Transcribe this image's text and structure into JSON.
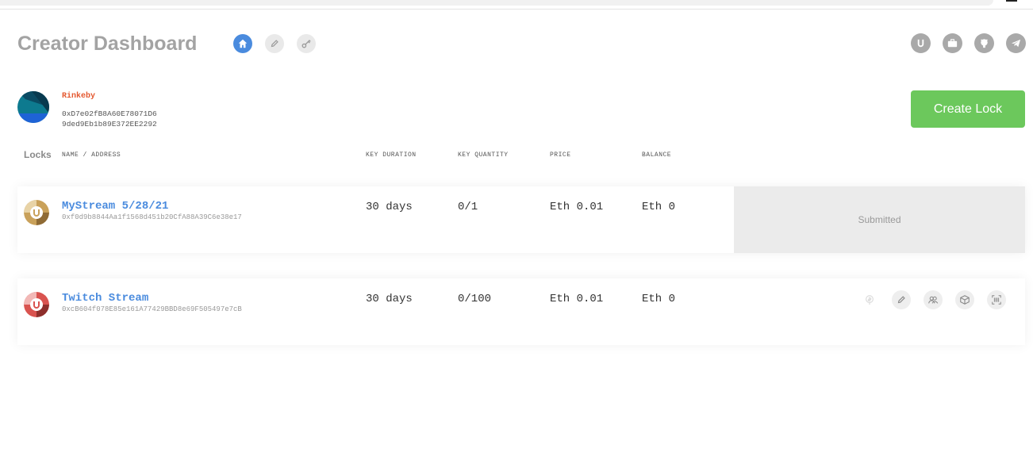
{
  "app": {
    "title": "Creator Dashboard"
  },
  "nav": [
    {
      "name": "home-icon",
      "active": true
    },
    {
      "name": "pencil-icon",
      "active": false
    },
    {
      "name": "key-icon",
      "active": false
    }
  ],
  "external_links": [
    "unlock-icon",
    "briefcase-icon",
    "github-icon",
    "telegram-icon"
  ],
  "account": {
    "network": "Rinkeby",
    "address_line1": "0xD7e02fB8A60E78071D6",
    "address_line2": "9ded9Eb1b89E372EE2292"
  },
  "buttons": {
    "create_lock": "Create Lock"
  },
  "table": {
    "locks_label": "Locks",
    "columns": [
      "NAME / ADDRESS",
      "KEY DURATION",
      "KEY QUANTITY",
      "PRICE",
      "BALANCE"
    ]
  },
  "locks": [
    {
      "name": "MyStream 5/28/21",
      "address": "0xf0d9b8844Aa1f1568d451b20CfA88A39C6e38e17",
      "duration": "30 days",
      "quantity": "0/1",
      "price": "Eth 0.01",
      "balance": "Eth 0",
      "status": "Submitted",
      "icon_color": "#c9a15a"
    },
    {
      "name": "Twitch Stream",
      "address": "0xcB604f078E85e161A77429BBD8e69F505497e7cB",
      "duration": "30 days",
      "quantity": "0/100",
      "price": "Eth 0.01",
      "balance": "Eth 0",
      "actions": [
        "withdraw-icon",
        "edit-icon",
        "members-icon",
        "code-icon",
        "barcode-icon"
      ],
      "icon_color": "#d9534f"
    }
  ],
  "colors": {
    "accent": "#4a8bde",
    "create_button": "#6cc85c",
    "network": "#e4572e"
  }
}
